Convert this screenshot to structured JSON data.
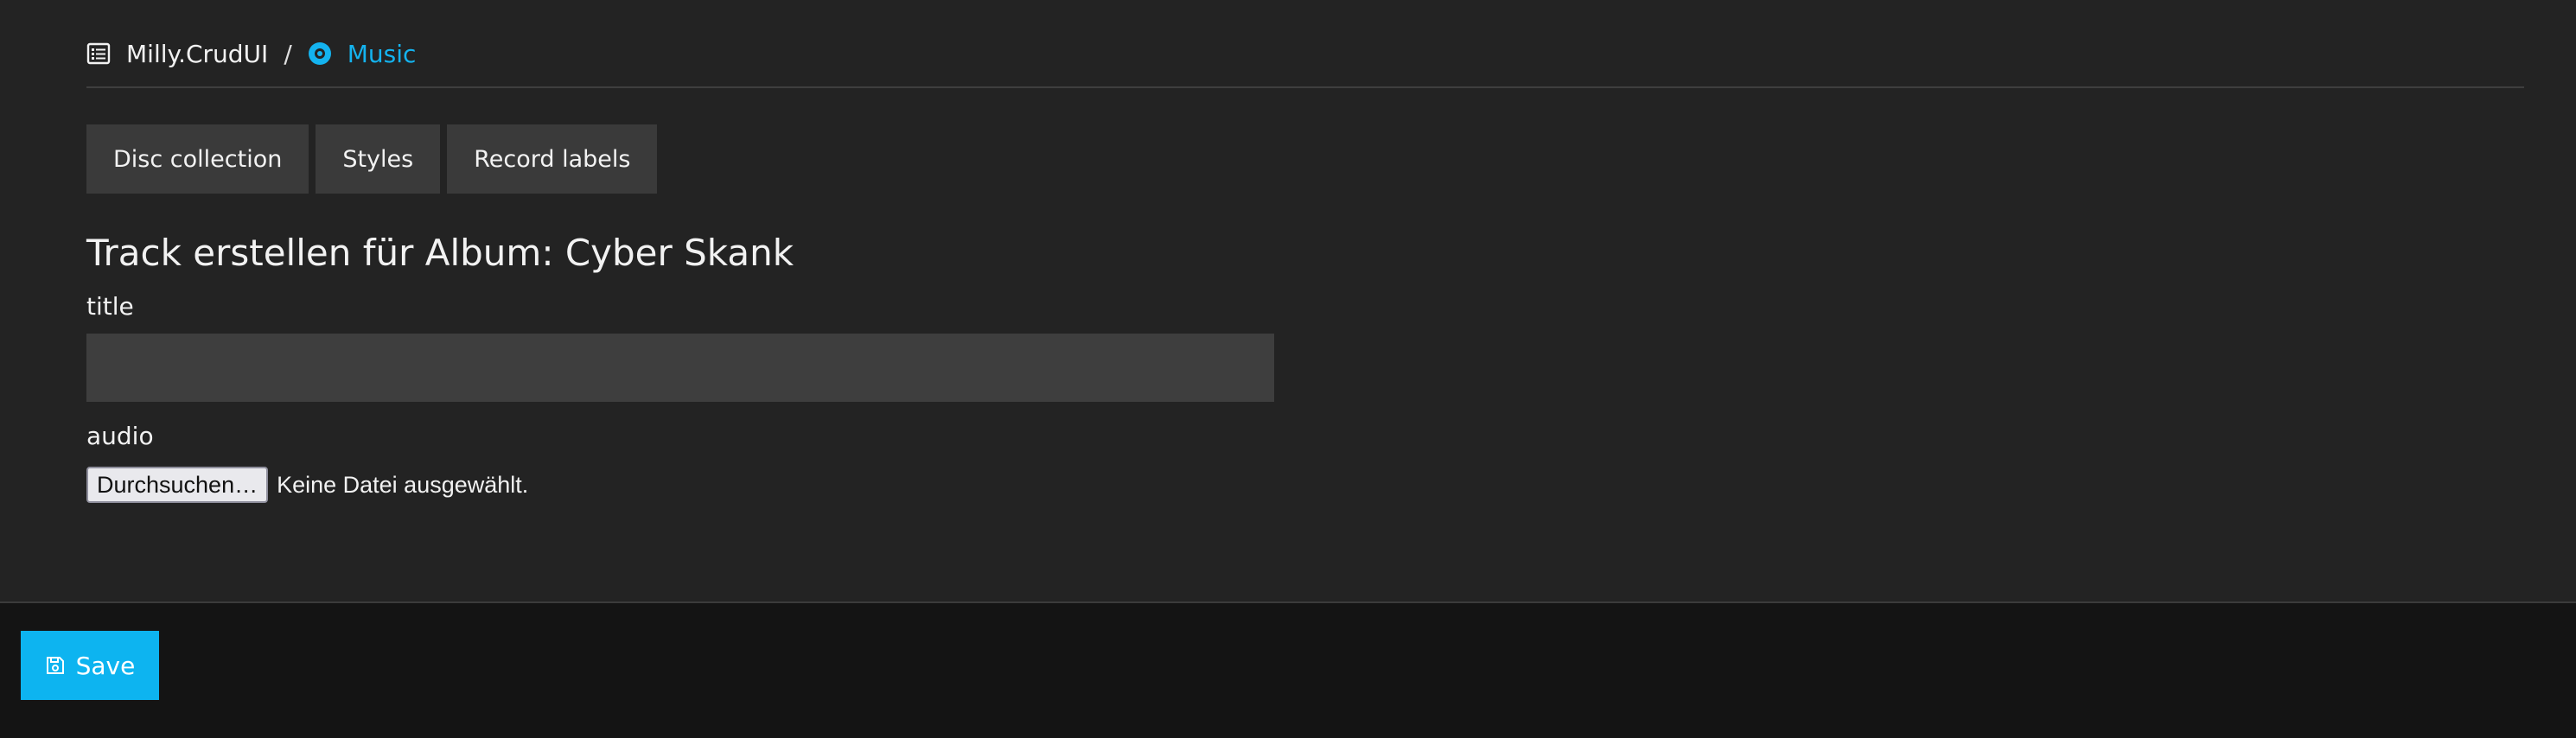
{
  "breadcrumb": {
    "app_icon": "list-icon",
    "app_name": "Milly.CrudUI",
    "separator": "/",
    "current_icon": "disc-icon",
    "current": "Music"
  },
  "tabs": [
    {
      "label": "Disc collection"
    },
    {
      "label": "Styles"
    },
    {
      "label": "Record labels"
    }
  ],
  "form": {
    "heading": "Track erstellen für Album: Cyber Skank",
    "title_label": "title",
    "title_value": "",
    "audio_label": "audio",
    "file_button": "Durchsuchen…",
    "file_status": "Keine Datei ausgewählt."
  },
  "footer": {
    "save_icon": "floppy-disk-icon",
    "save_label": "Save"
  },
  "colors": {
    "background": "#232323",
    "footer_background": "#141414",
    "accent": "#0db4f0",
    "tab_background": "#3a3a3a",
    "input_background": "#3e3e3e"
  }
}
